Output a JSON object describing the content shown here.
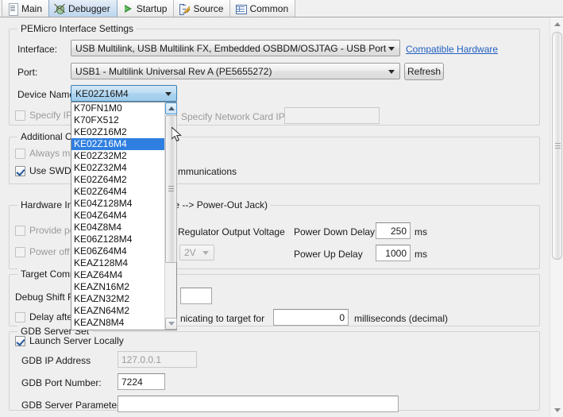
{
  "tabs": [
    {
      "label": "Main",
      "icon": "document-icon",
      "active": false
    },
    {
      "label": "Debugger",
      "icon": "bug-icon",
      "active": true
    },
    {
      "label": "Startup",
      "icon": "play-icon",
      "active": false
    },
    {
      "label": "Source",
      "icon": "source-tree-icon",
      "active": false
    },
    {
      "label": "Common",
      "icon": "table-icon",
      "active": false
    }
  ],
  "interface_settings": {
    "group_label": "PEMicro Interface Settings",
    "interface_label": "Interface:",
    "interface_value": "USB Multilink, USB Multilink FX, Embedded OSBDM/OSJTAG - USB Port",
    "compatible_hardware_link": "Compatible Hardware",
    "port_label": "Port:",
    "port_value": "USB1 - Multilink Universal Rev A (PE5655272)",
    "refresh_button": "Refresh",
    "device_name_label": "Device Name:",
    "device_name_value": "KE02Z16M4",
    "specify_ip_label": "Specify IP",
    "specify_ip_checked": false,
    "specify_network_card_ip_label": "Specify Network Card IP",
    "network_card_ip_value": ""
  },
  "device_dropdown": {
    "name": "device-name-dropdown",
    "selected": "KE02Z16M4",
    "items": [
      "K70FN1M0",
      "K70FX512",
      "KE02Z16M2",
      "KE02Z16M4",
      "KE02Z32M2",
      "KE02Z32M4",
      "KE02Z64M2",
      "KE02Z64M4",
      "KE04Z128M4",
      "KE04Z64M4",
      "KE04Z8M4",
      "KE06Z128M4",
      "KE06Z64M4",
      "KEAZ128M4",
      "KEAZ64M4",
      "KEAZN16M2",
      "KEAZN32M2",
      "KEAZN64M2",
      "KEAZN8M4"
    ]
  },
  "additional_options": {
    "group_label": "Additional Opt",
    "always_mass_erase_label": "Always mas",
    "always_mass_erase_checked": false,
    "use_swd_label": "Use SWD re",
    "use_swd_checked": true,
    "communications_text": "mmunications"
  },
  "hardware_interface": {
    "group_label": "Hardware Inter",
    "group_label_tail": "age --> Power-Out Jack)",
    "provide_power_label": "Provide pov",
    "provide_power_checked": false,
    "power_off_label": "Power off ta",
    "power_off_checked": false,
    "regulator_label": "Regulator Output Voltage",
    "regulator_value": "2V",
    "power_down_delay_label": "Power Down Delay",
    "power_down_delay_value": "250",
    "power_down_delay_unit": "ms",
    "power_up_delay_label": "Power Up Delay",
    "power_up_delay_value": "1000",
    "power_up_delay_unit": "ms"
  },
  "target_communication": {
    "group_label": "Target Commu",
    "debug_shift_label": "Debug Shift Fre",
    "debug_shift_value": "",
    "delay_after_reset_label": "Delay after R",
    "delay_after_reset_checked": false,
    "communicating_text": "nicating to target for",
    "delay_value": "0",
    "delay_unit": "milliseconds (decimal)"
  },
  "gdb_server": {
    "group_label": "GDB Server Set",
    "launch_server_label": "Launch Server Locally",
    "launch_server_checked": true,
    "ip_label": "GDB IP Address",
    "ip_value": "127.0.0.1",
    "port_label": "GDB Port Number:",
    "port_value": "7224",
    "params_label": "GDB Server Parameters:",
    "params_value": ""
  },
  "colors": {
    "accent_selection": "#2f7fe0",
    "link": "#2060c0",
    "panel_bg": "#efefef",
    "combo_open": "#9fcdec"
  }
}
